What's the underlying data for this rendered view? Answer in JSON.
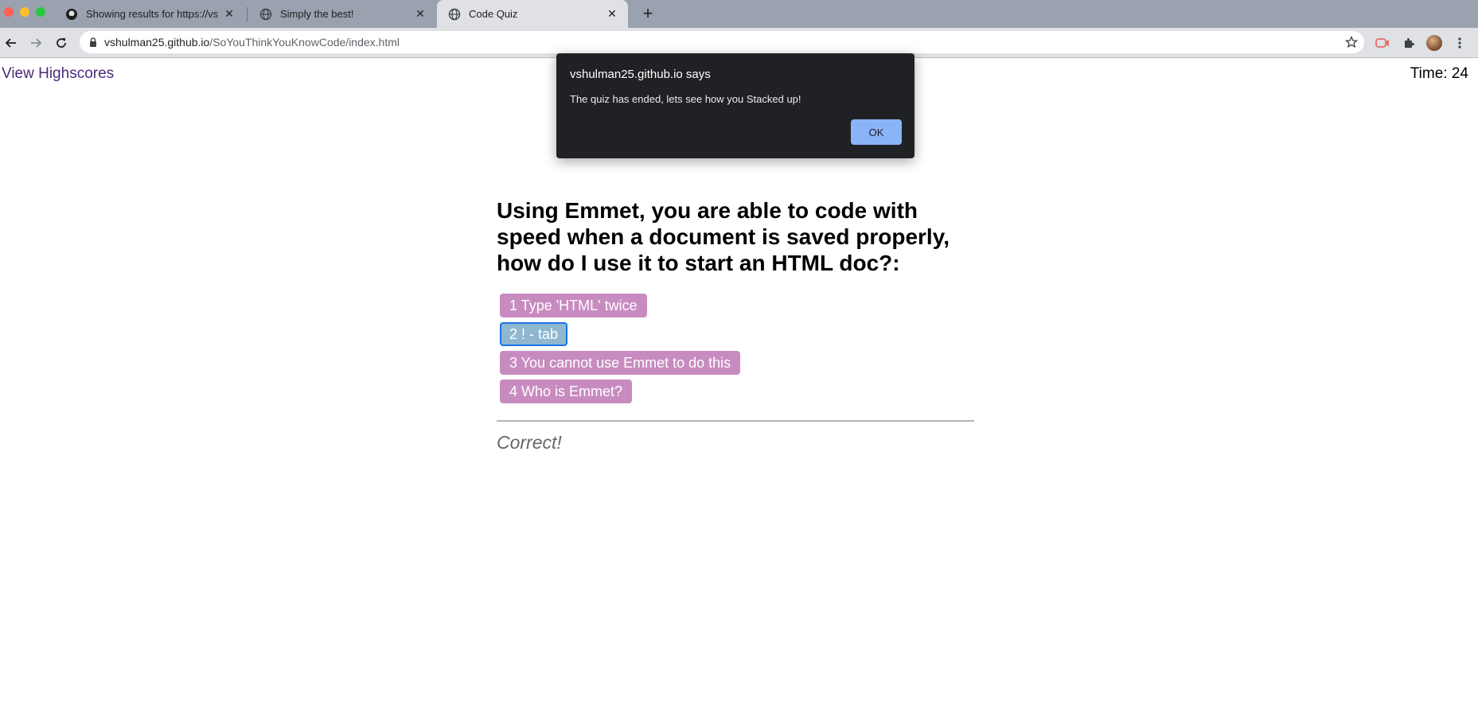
{
  "browser": {
    "tabs": [
      {
        "title": "Showing results for https://vsh",
        "icon": "github-octocat-icon",
        "active": false
      },
      {
        "title": "Simply the best!",
        "icon": "globe-icon",
        "active": false
      },
      {
        "title": "Code Quiz",
        "icon": "globe-icon",
        "active": true
      }
    ],
    "url_host": "vshulman25.github.io",
    "url_path": "/SoYouThinkYouKnowCode/index.html"
  },
  "page": {
    "highscores_link": "View Highscores",
    "timer": "Time: 24",
    "question": "Using Emmet, you are able to code with speed when a document is saved properly, how do I use it to start an HTML doc?:",
    "answers": [
      "1 Type 'HTML' twice",
      "2 ! - tab",
      "3 You cannot use Emmet to do this",
      "4 Who is Emmet?"
    ],
    "selected_answer_index": 1,
    "feedback": "Correct!"
  },
  "alert": {
    "title": "vshulman25.github.io says",
    "message": "The quiz has ended, lets see how you Stacked up!",
    "ok_label": "OK"
  },
  "colors": {
    "answer_bg": "#c78bc0",
    "answer_selected_bg": "#8fb7d0",
    "alert_bg": "#202124",
    "alert_button": "#8ab4f8",
    "link": "#4a2a7a"
  }
}
